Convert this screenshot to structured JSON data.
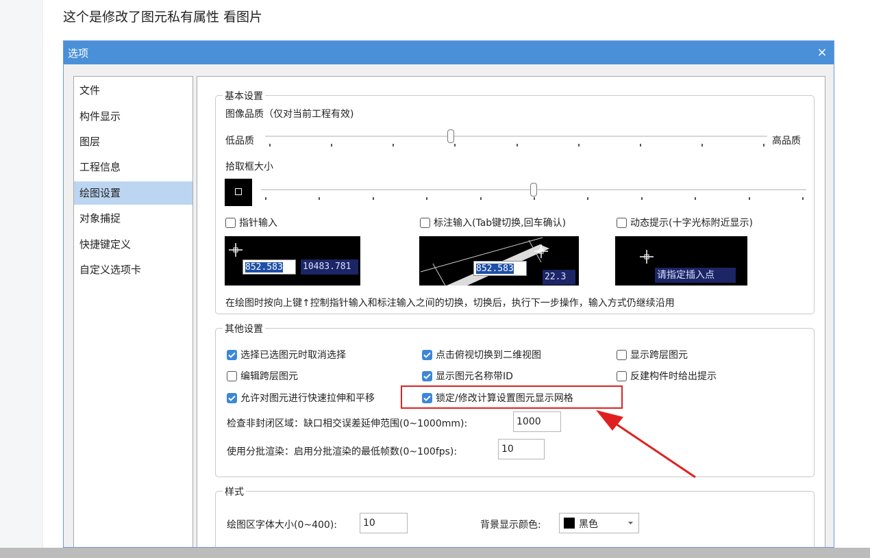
{
  "caption": "这个是修改了图元私有属性   看图片",
  "dialog": {
    "title": "选项",
    "close_label": "×"
  },
  "nav": {
    "items": [
      {
        "label": "文件"
      },
      {
        "label": "构件显示"
      },
      {
        "label": "图层"
      },
      {
        "label": "工程信息"
      },
      {
        "label": "绘图设置",
        "active": true
      },
      {
        "label": "对象捕捉"
      },
      {
        "label": "快捷键定义"
      },
      {
        "label": "自定义选项卡"
      }
    ]
  },
  "basic": {
    "legend": "基本设置",
    "quality_label": "图像品质（仅对当前工程有效)",
    "quality_low": "低品质",
    "quality_high": "高品质",
    "quality_level": 0.37,
    "pick_label": "拾取框大小",
    "pick_level": 0.5,
    "cb_pointer": "指针输入",
    "cb_dim": "标注输入(Tab键切换,回车确认)",
    "cb_dynamic": "动态提示(十字光标附近显示)",
    "preview1_val1": "852.583",
    "preview1_val2": "10483.781",
    "preview2_val1": "852.583",
    "preview2_val2": "22.3",
    "preview3_text": "请指定插入点",
    "hint": "在绘图时按向上键↑控制指针输入和标注输入之间的切换，切换后，执行下一步操作，输入方式仍继续沿用"
  },
  "other": {
    "legend": "其他设置",
    "checkboxes": [
      {
        "label": "选择已选图元时取消选择",
        "checked": true
      },
      {
        "label": "点击俯视切换到二维视图",
        "checked": true
      },
      {
        "label": "显示跨层图元",
        "checked": false
      },
      {
        "label": "编辑跨层图元",
        "checked": false
      },
      {
        "label": "显示图元名称带ID",
        "checked": true
      },
      {
        "label": "反建构件时给出提示",
        "checked": false
      },
      {
        "label": "允许对图元进行快速拉伸和平移",
        "checked": true
      },
      {
        "label": "锁定/修改计算设置图元显示网格",
        "checked": true
      }
    ],
    "gap_label": "检查非封闭区域：缺口相交误差延伸范围(0~1000mm):",
    "gap_value": "1000",
    "batch_label": "使用分批渲染：启用分批渲染的最低帧数(0~100fps):",
    "batch_value": "10"
  },
  "style": {
    "legend": "样式",
    "font_size_label": "绘图区字体大小(0~400):",
    "font_size_value": "10",
    "bg_color_label": "背景显示颜色:",
    "bg_color_value": "黑色"
  },
  "colors": {
    "titlebar": "#4a90d9",
    "checkbox_on": "#3d87d8",
    "annotation": "#e02020"
  }
}
